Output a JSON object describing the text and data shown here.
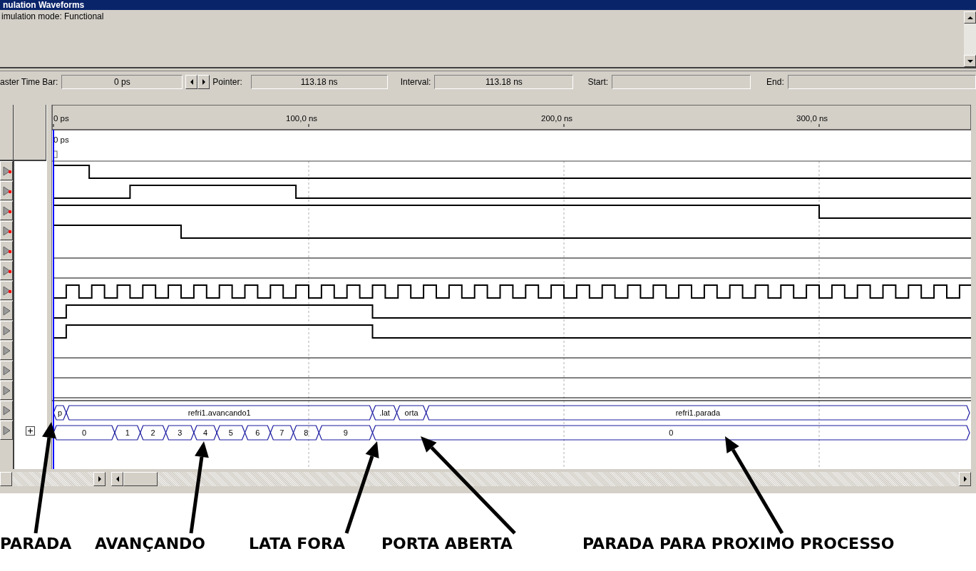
{
  "window": {
    "title": "nulation Waveforms"
  },
  "info": {
    "text": "imulation mode: Functional"
  },
  "time_bar": {
    "master_label": "aster Time Bar:",
    "master_value": "0 ps",
    "pointer_label": "Pointer:",
    "pointer_value": "113.18 ns",
    "interval_label": "Interval:",
    "interval_value": "113.18 ns",
    "start_label": "Start:",
    "end_label": "End:"
  },
  "ruler": {
    "ticks": [
      "0 ps",
      "100,0 ns",
      "200,0 ns",
      "300,0 ns"
    ],
    "marker": "0 ps"
  },
  "signals": [
    {
      "kind": "input"
    },
    {
      "kind": "input"
    },
    {
      "kind": "input"
    },
    {
      "kind": "input"
    },
    {
      "kind": "input"
    },
    {
      "kind": "input"
    },
    {
      "kind": "input"
    },
    {
      "kind": "output"
    },
    {
      "kind": "output"
    },
    {
      "kind": "output"
    },
    {
      "kind": "output"
    },
    {
      "kind": "output"
    },
    {
      "kind": "output",
      "values": [
        "p",
        "refri1.avancando1",
        ".lat",
        "orta",
        "refri1.parada"
      ]
    },
    {
      "kind": "output",
      "expanded": false,
      "values": [
        "0",
        "1",
        "2",
        "3",
        "4",
        "5",
        "6",
        "7",
        "8",
        "9",
        "0"
      ]
    }
  ],
  "annotations": [
    "PARADA",
    "AVANÇANDO",
    "LATA FORA",
    "PORTA ABERTA",
    "PARADA PARA PROXIMO PROCESSO"
  ]
}
